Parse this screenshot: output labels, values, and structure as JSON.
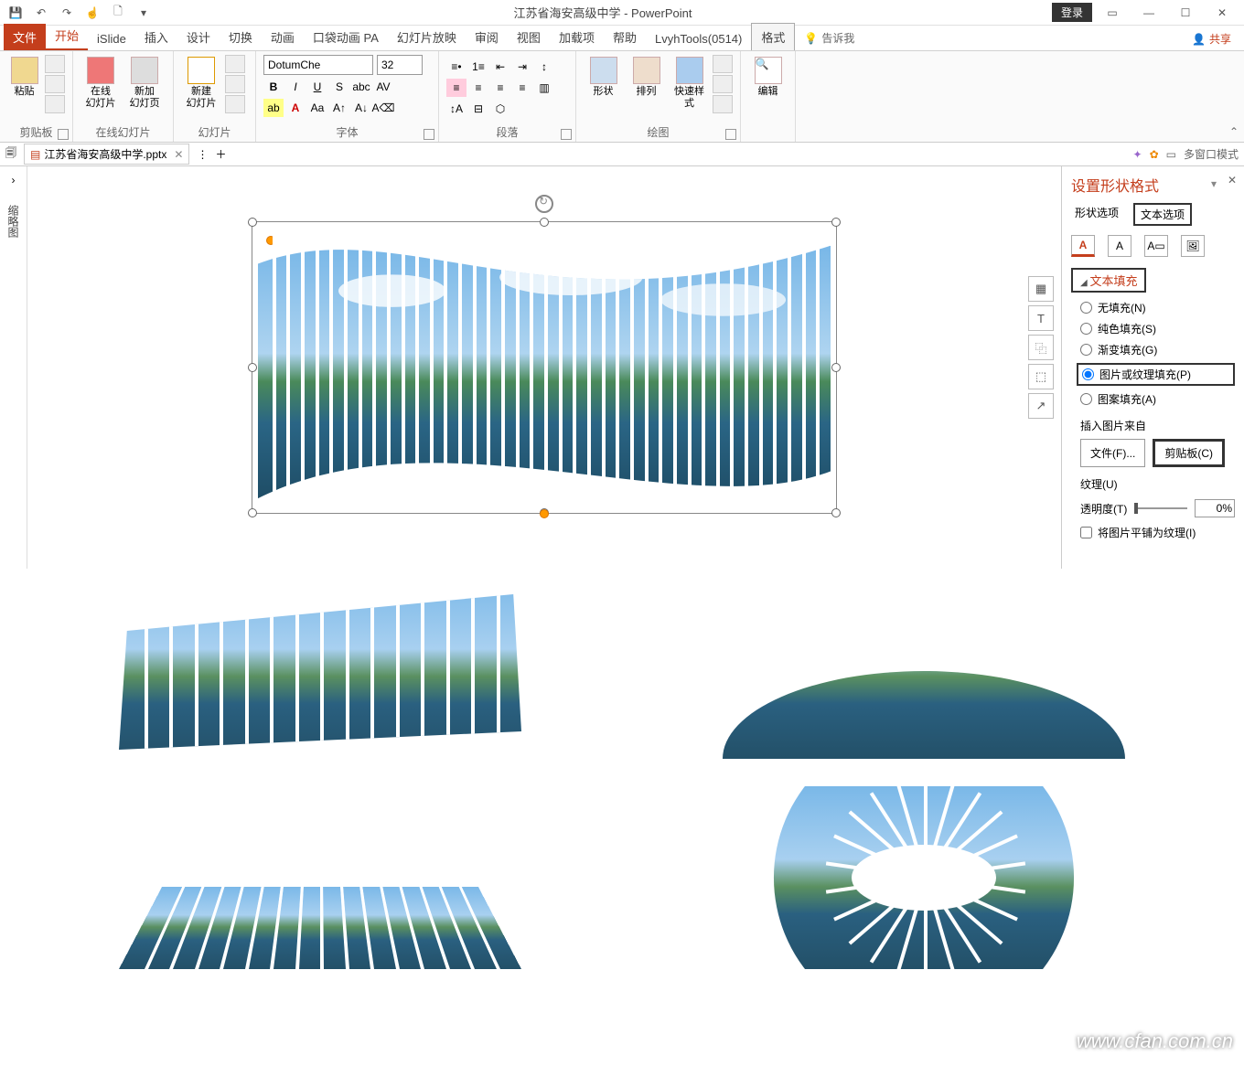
{
  "title": "江苏省海安高级中学 - PowerPoint",
  "login": "登录",
  "tabs": {
    "file": "文件",
    "home": "开始",
    "islide": "iSlide",
    "insert": "插入",
    "design": "设计",
    "transition": "切换",
    "animation": "动画",
    "kouda": "口袋动画 PA",
    "slideshow": "幻灯片放映",
    "review": "审阅",
    "view": "视图",
    "addin": "加载项",
    "help": "帮助",
    "lvyh": "LvyhTools(0514)",
    "format": "格式",
    "tell": "告诉我",
    "share": "共享"
  },
  "groups": {
    "clipboard": {
      "paste": "粘贴",
      "label": "剪贴板"
    },
    "online": {
      "btn1": "在线\n幻灯片",
      "btn2": "新加\n幻灯页",
      "label": "在线幻灯片"
    },
    "slides": {
      "btn": "新建\n幻灯片",
      "label": "幻灯片"
    },
    "font": {
      "name": "DotumChe",
      "size": "32",
      "label": "字体"
    },
    "para": {
      "label": "段落"
    },
    "draw": {
      "shape": "形状",
      "arrange": "排列",
      "quick": "快速样式",
      "label": "绘图"
    },
    "edit": {
      "label": "编辑"
    }
  },
  "fileTab": {
    "name": "江苏省海安高级中学.pptx",
    "multi": "多窗口模式"
  },
  "leftRail": "缩略图",
  "pane": {
    "title": "设置形状格式",
    "tab1": "形状选项",
    "tab2": "文本选项",
    "section": "文本填充",
    "r1": "无填充(N)",
    "r2": "纯色填充(S)",
    "r3": "渐变填充(G)",
    "r4": "图片或纹理填充(P)",
    "r5": "图案填充(A)",
    "insertFrom": "插入图片来自",
    "fileBtn": "文件(F)...",
    "clipBtn": "剪贴板(C)",
    "texture": "纹理(U)",
    "trans": "透明度(T)",
    "transVal": "0%",
    "tile": "将图片平铺为纹理(I)"
  },
  "watermark": "www.cfan.com.cn"
}
